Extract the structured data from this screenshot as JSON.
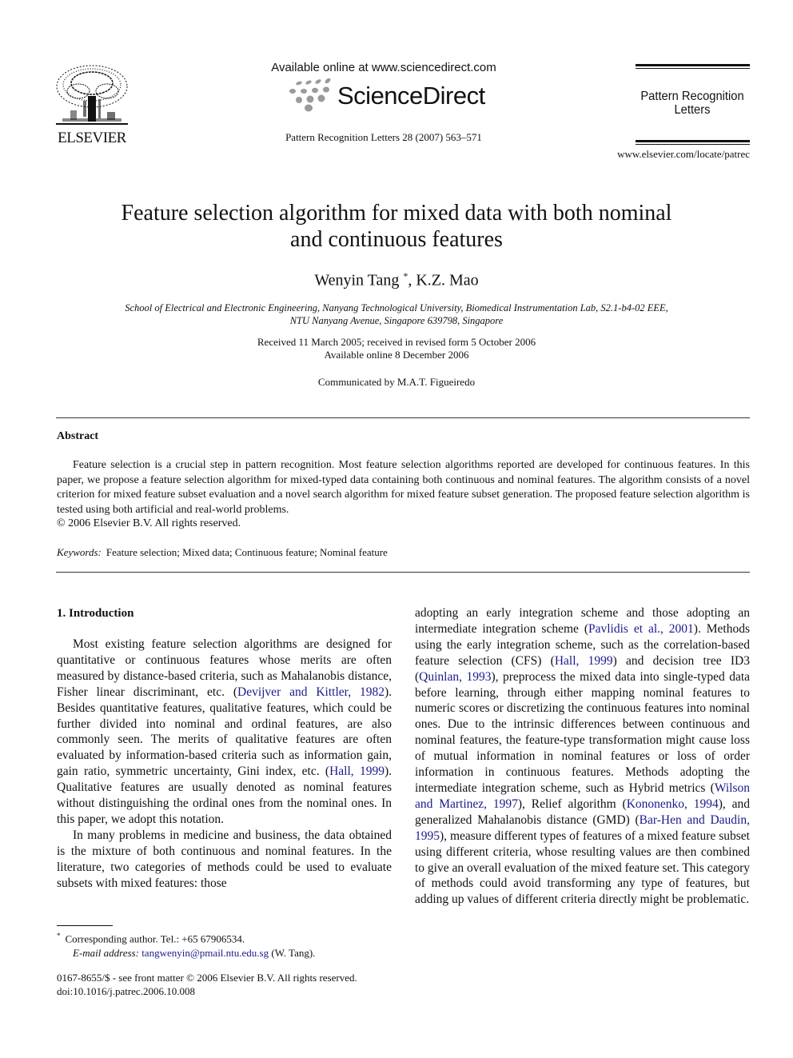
{
  "header": {
    "publisher_name": "ELSEVIER",
    "available_online": "Available online at www.sciencedirect.com",
    "platform_name": "ScienceDirect",
    "journal_reference": "Pattern Recognition Letters 28 (2007) 563–571",
    "journal_name_line1": "Pattern Recognition",
    "journal_name_line2": "Letters",
    "journal_url": "www.elsevier.com/locate/patrec",
    "icons": {
      "publisher_logo": "elsevier-tree-icon",
      "platform_logo": "sciencedirect-dots-icon"
    }
  },
  "article": {
    "title_line1": "Feature selection algorithm for mixed data with both nominal",
    "title_line2": "and continuous features",
    "author1": "Wenyin Tang",
    "author1_mark": "*",
    "author_sep": ", ",
    "author2": "K.Z. Mao",
    "affiliation_line1": "School of Electrical and Electronic Engineering, Nanyang Technological University, Biomedical Instrumentation Lab, S2.1-b4-02 EEE,",
    "affiliation_line2": "NTU Nanyang Avenue, Singapore 639798, Singapore",
    "received": "Received 11 March 2005; received in revised form 5 October 2006",
    "available": "Available online 8 December 2006",
    "communicated": "Communicated by M.A.T. Figueiredo"
  },
  "abstract": {
    "heading": "Abstract",
    "text": "Feature selection is a crucial step in pattern recognition. Most feature selection algorithms reported are developed for continuous features. In this paper, we propose a feature selection algorithm for mixed-typed data containing both continuous and nominal features. The algorithm consists of a novel criterion for mixed feature subset evaluation and a novel search algorithm for mixed feature subset generation. The proposed feature selection algorithm is tested using both artificial and real-world problems.",
    "copyright": "© 2006 Elsevier B.V. All rights reserved.",
    "keywords_label": "Keywords:",
    "keywords": "Feature selection; Mixed data; Continuous feature; Nominal feature"
  },
  "introduction": {
    "heading": "1. Introduction",
    "p1": {
      "t1": "Most existing feature selection algorithms are designed for quantitative or continuous features whose merits are often measured by distance-based criteria, such as Mahalanobis distance, Fisher linear discriminant, etc. (",
      "c1": "Devijver and Kittler, 1982",
      "t2": "). Besides quantitative features, qualitative features, which could be further divided into nominal and ordinal features, are also commonly seen. The merits of qualitative features are often evaluated by information-based criteria such as information gain, gain ratio, symmetric uncertainty, Gini index, etc. (",
      "c2": "Hall, 1999",
      "t3": "). Qualitative features are usually denoted as nominal features without distinguishing the ordinal ones from the nominal ones. In this paper, we adopt this notation."
    },
    "p2": {
      "t1": "In many problems in medicine and business, the data obtained is the mixture of both continuous and nominal features. In the literature, two categories of methods could be used to evaluate subsets with mixed features: those"
    },
    "p2_cont": {
      "t1": "adopting an early integration scheme and those adopting an intermediate integration scheme (",
      "c1": "Pavlidis et al., 2001",
      "t2": "). Methods using the early integration scheme, such as the correlation-based feature selection (CFS) (",
      "c2": "Hall, 1999",
      "t3": ") and decision tree ID3 (",
      "c3": "Quinlan, 1993",
      "t4": "), preprocess the mixed data into single-typed data before learning, through either mapping nominal features to numeric scores or discretizing the continuous features into nominal ones. Due to the intrinsic differences between continuous and nominal features, the feature-type transformation might cause loss of mutual information in nominal features or loss of order information in continuous features. Methods adopting the intermediate integration scheme, such as Hybrid metrics (",
      "c4": "Wilson and Martinez, 1997",
      "t5": "), Relief algorithm (",
      "c5": "Kononenko, 1994",
      "t6": "), and generalized Mahalanobis distance (GMD) (",
      "c6": "Bar-Hen and Daudin, 1995",
      "t7": "), measure different types of features of a mixed feature subset using different criteria, whose resulting values are then combined to give an overall evaluation of the mixed feature set. This category of methods could avoid transforming any type of features, but adding up values of different criteria directly might be problematic."
    }
  },
  "footnote": {
    "mark": "*",
    "corresponding": "Corresponding author. Tel.: +65 67906534.",
    "email_label": "E-mail address:",
    "email": "tangwenyin@pmail.ntu.edu.sg",
    "email_suffix": " (W. Tang)."
  },
  "front_matter": {
    "issn_line": "0167-8655/$ - see front matter © 2006 Elsevier B.V. All rights reserved.",
    "doi": "doi:10.1016/j.patrec.2006.10.008"
  },
  "colors": {
    "text": "#111111",
    "link": "#1a1a8c",
    "logo_gray": "#9a9a9a"
  }
}
